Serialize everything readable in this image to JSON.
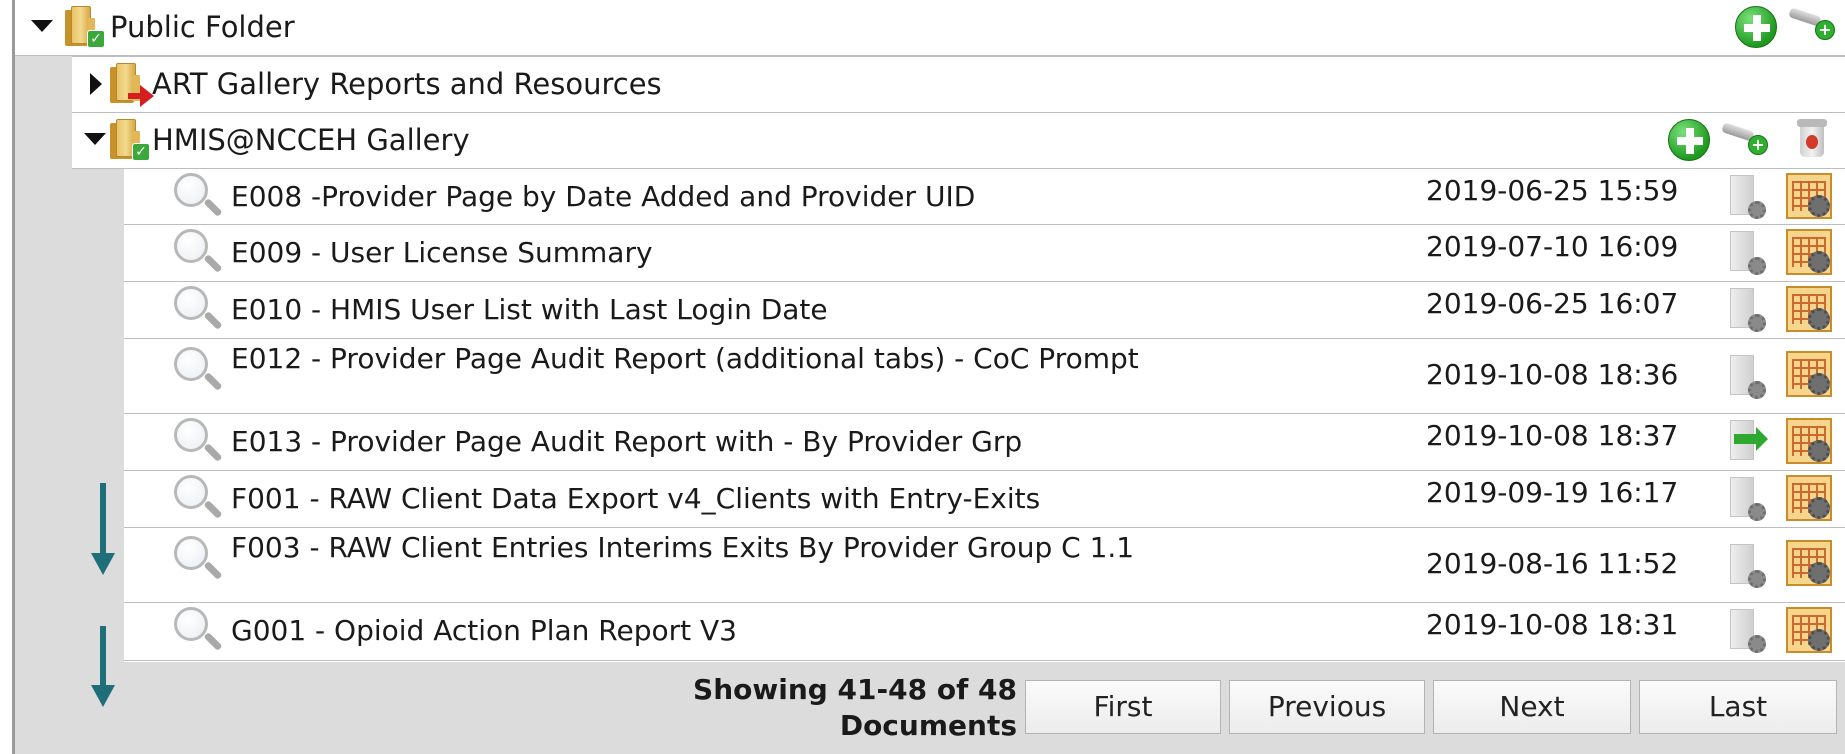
{
  "tree": {
    "public_folder": {
      "label": "Public Folder",
      "expanded": true
    },
    "art_gallery": {
      "label": "ART Gallery Reports and Resources",
      "expanded": false
    },
    "hmis_gallery": {
      "label": "HMIS@NCCEH Gallery",
      "expanded": true
    }
  },
  "documents": [
    {
      "title": "E008 -Provider Page by Date Added and Provider UID",
      "date": "2019-06-25 15:59",
      "schedule_icon": "schedule-icon"
    },
    {
      "title": "E009 - User License Summary",
      "date": "2019-07-10 16:09",
      "schedule_icon": "schedule-icon"
    },
    {
      "title": "E010 - HMIS User List with Last Login Date",
      "date": "2019-06-25 16:07",
      "schedule_icon": "schedule-icon"
    },
    {
      "title": "E012 - Provider Page Audit Report (additional tabs) - CoC Prompt",
      "date": "2019-10-08 18:36",
      "schedule_icon": "schedule-icon"
    },
    {
      "title": "E013 - Provider Page Audit Report with - By Provider Grp",
      "date": "2019-10-08 18:37",
      "schedule_icon": "scheduled-arrow-icon"
    },
    {
      "title": "F001 - RAW Client Data Export v4_Clients with Entry-Exits",
      "date": "2019-09-19 16:17",
      "schedule_icon": "schedule-icon"
    },
    {
      "title": "F003 - RAW Client Entries Interims Exits By Provider Group C 1.1",
      "date": "2019-08-16 11:52",
      "schedule_icon": "schedule-icon"
    },
    {
      "title": "G001 - Opioid Action Plan Report V3",
      "date": "2019-10-08 18:31",
      "schedule_icon": "schedule-icon"
    }
  ],
  "pager": {
    "showing_line1": "Showing 41-48 of 48",
    "showing_line2": "Documents",
    "first": "First",
    "previous": "Previous",
    "next": "Next",
    "last": "Last"
  },
  "colors": {
    "accent_arrow": "#1f6f7b",
    "gutter": "#dcdcdc",
    "add_green": "#1f9a1f"
  }
}
